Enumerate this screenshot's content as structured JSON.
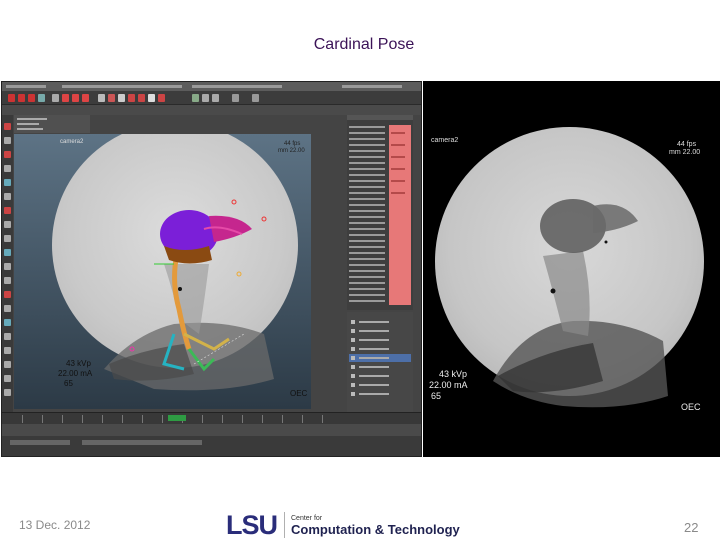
{
  "slide": {
    "title": "Cardinal Pose",
    "date": "13 Dec. 2012",
    "page_number": "22"
  },
  "logo": {
    "mark": "LSU",
    "small_text": "Center for",
    "big_text": "Computation & Technology"
  },
  "left_screenshot": {
    "viewport_label_top_left": "camera2",
    "viewport_label_top_right_1": "44 fps",
    "viewport_label_top_right_2": "mm 22.00",
    "bottom_left_1": "43 kVp",
    "bottom_left_2": "22.00 mA",
    "bottom_left_3": "65",
    "bottom_right": "OEC",
    "colors": {
      "bird_skull": "#7b1fd8",
      "bird_beak": "#c5268e",
      "spine": "#e39a3c",
      "channel_red": "#e77878",
      "timeline_green": "#2e9b43"
    }
  },
  "right_xray": {
    "top_left": "camera2",
    "top_right_1": "44 fps",
    "top_right_2": "mm 22.00",
    "bottom_left_1": "43 kVp",
    "bottom_left_2": "22.00 mA",
    "bottom_left_3": "65",
    "bottom_right": "OEC"
  }
}
